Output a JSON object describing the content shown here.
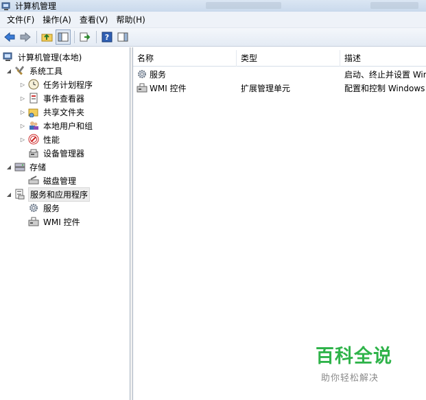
{
  "window": {
    "title": "计算机管理"
  },
  "menu": {
    "items": [
      "文件(F)",
      "操作(A)",
      "查看(V)",
      "帮助(H)"
    ]
  },
  "tree": {
    "root": "计算机管理(本地)",
    "system_tools": "系统工具",
    "task_scheduler": "任务计划程序",
    "event_viewer": "事件查看器",
    "shared_folders": "共享文件夹",
    "local_users": "本地用户和组",
    "performance": "性能",
    "device_manager": "设备管理器",
    "storage": "存储",
    "disk_management": "磁盘管理",
    "services_apps": "服务和应用程序",
    "services": "服务",
    "wmi_control": "WMI 控件"
  },
  "list": {
    "columns": [
      "名称",
      "类型",
      "描述"
    ],
    "rows": [
      {
        "name": "服务",
        "type": "",
        "desc": "启动、终止并设置 Win"
      },
      {
        "name": "WMI 控件",
        "type": "扩展管理单元",
        "desc": "配置和控制 Windows"
      }
    ]
  },
  "watermark": {
    "title": "百科全说",
    "subtitle": "助你轻松解决"
  },
  "colors": {
    "watermark_green": "#2fb34a",
    "toolbar_bg": "#e4ebf4",
    "titlebar_bg": "#c9d9ec"
  }
}
